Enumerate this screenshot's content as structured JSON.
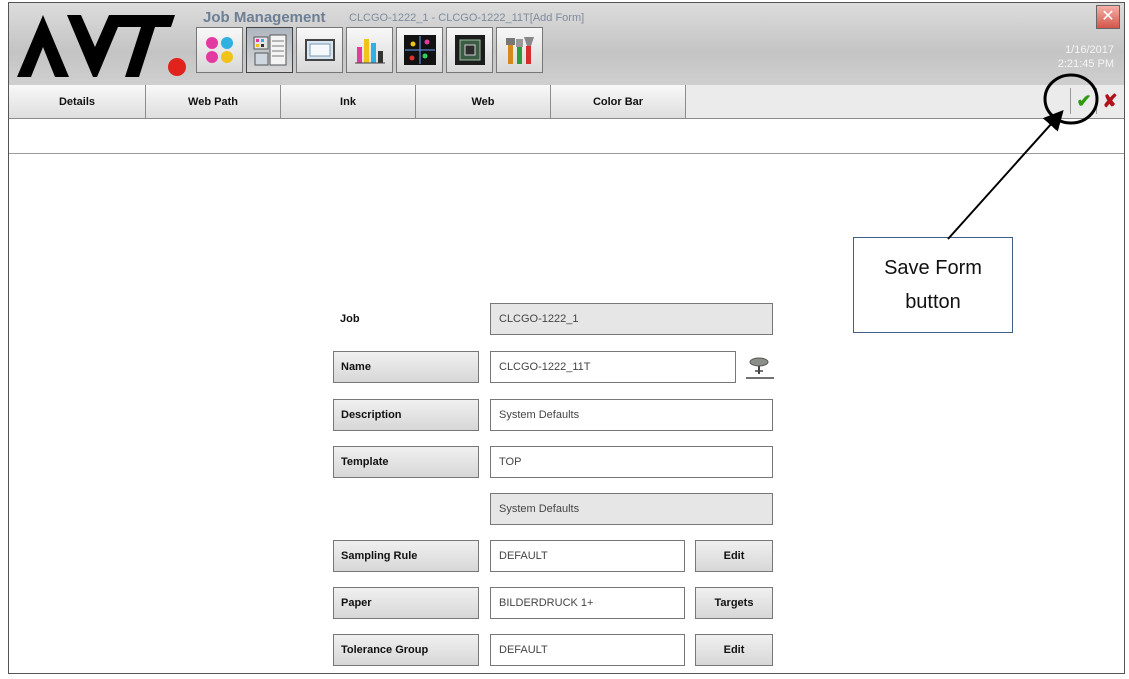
{
  "header": {
    "logo_text": "AVT.",
    "app_title": "Job Management",
    "job_path": "CLCGO-1222_1 - CLCGO-1222_11T[Add Form]",
    "date": "1/16/2017",
    "time": "2:21:45 PM",
    "close_glyph": "✕",
    "toolbar_icons": [
      "color-patches-icon",
      "job-management-icon",
      "monitor-icon",
      "bar-chart-icon",
      "scatter-plot-icon",
      "frame-icon",
      "tools-icon"
    ],
    "active_tool_index": 1
  },
  "tabs": [
    "Details",
    "Web Path",
    "Ink",
    "Web",
    "Color Bar"
  ],
  "actions": {
    "save_glyph": "✔",
    "cancel_glyph": "✘"
  },
  "form": {
    "job_label": "Job",
    "job_value": "CLCGO-1222_1",
    "name_label": "Name",
    "name_value": "CLCGO-1222_11T",
    "description_label": "Description",
    "description_value": "System Defaults",
    "template_label": "Template",
    "template_value": "TOP",
    "template_info": "System Defaults",
    "sampling_rule_label": "Sampling Rule",
    "sampling_rule_value": "DEFAULT",
    "sampling_rule_button": "Edit",
    "paper_label": "Paper",
    "paper_value": "BILDERDRUCK 1+",
    "paper_button": "Targets",
    "tolerance_label": "Tolerance Group",
    "tolerance_value": "DEFAULT",
    "tolerance_button": "Edit"
  },
  "callout": {
    "line1": "Save Form",
    "line2": "button"
  },
  "colors": {
    "brand_black": "#000000",
    "brand_dot": "#e0231c",
    "save_green": "#2e9a10",
    "cancel_red": "#b1131a",
    "callout_border": "#3f5f83"
  }
}
